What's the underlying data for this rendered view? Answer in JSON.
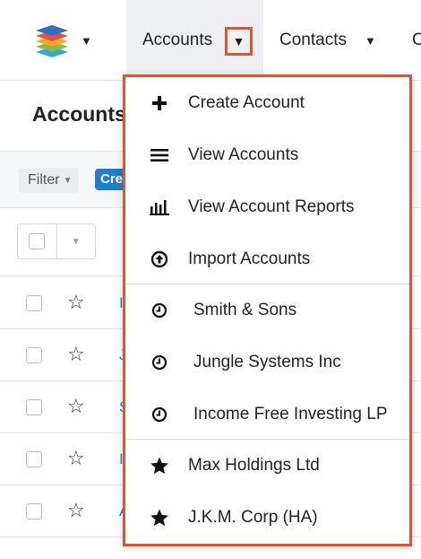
{
  "nav": {
    "accounts_label": "Accounts",
    "contacts_label": "Contacts",
    "more_label": "C"
  },
  "page": {
    "title": "Accounts",
    "filter_label": "Filter",
    "create_label": "Create"
  },
  "table": {
    "row_link_fragments": [
      "I",
      "J",
      "S",
      "I",
      "A"
    ]
  },
  "menu": {
    "actions": [
      {
        "label": "Create Account",
        "icon": "plus-icon"
      },
      {
        "label": "View Accounts",
        "icon": "list-icon"
      },
      {
        "label": "View Account Reports",
        "icon": "bar-chart-icon"
      },
      {
        "label": "Import Accounts",
        "icon": "upload-circle-icon"
      }
    ],
    "recents": [
      {
        "label": "Smith & Sons",
        "icon": "clock-icon"
      },
      {
        "label": "Jungle Systems Inc",
        "icon": "clock-icon"
      },
      {
        "label": "Income Free Investing LP",
        "icon": "clock-icon"
      }
    ],
    "favorites": [
      {
        "label": "Max Holdings Ltd",
        "icon": "star-filled-icon"
      },
      {
        "label": "J.K.M. Corp (HA)",
        "icon": "star-filled-icon"
      }
    ]
  },
  "colors": {
    "highlight": "#e2542b",
    "brand_blue": "#1a80cf"
  }
}
